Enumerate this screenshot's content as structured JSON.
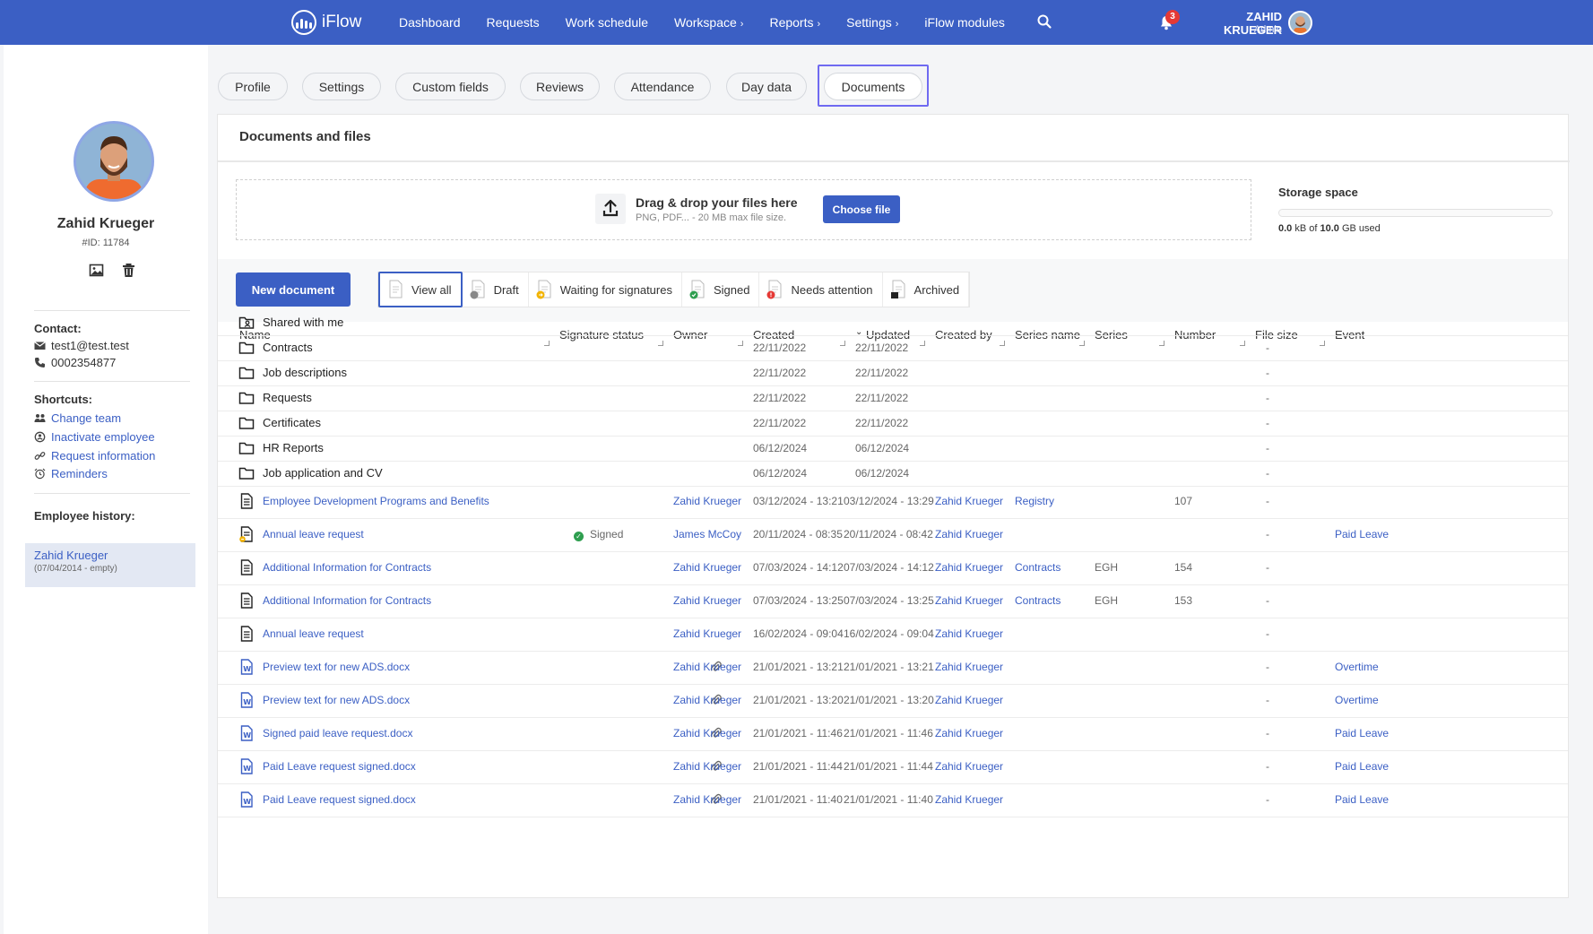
{
  "app": {
    "logo_text": "iFlow"
  },
  "nav": {
    "items": [
      {
        "label": "Dashboard",
        "chevron": false
      },
      {
        "label": "Requests",
        "chevron": false
      },
      {
        "label": "Work schedule",
        "chevron": false
      },
      {
        "label": "Workspace",
        "chevron": true
      },
      {
        "label": "Reports",
        "chevron": true
      },
      {
        "label": "Settings",
        "chevron": true
      },
      {
        "label": "iFlow modules",
        "chevron": false
      }
    ],
    "search_icon": "search-icon"
  },
  "user": {
    "name": "ZAHID KRUEGER",
    "role": "Admin",
    "notifications": "3"
  },
  "profile": {
    "name": "Zahid Krueger",
    "id": "#ID: 11784",
    "contact_title": "Contact:",
    "email": "test1@test.test",
    "phone": "0002354877",
    "shortcuts_title": "Shortcuts:",
    "shortcuts": [
      "Change team",
      "Inactivate employee",
      "Request information",
      "Reminders"
    ],
    "history_title": "Employee history:",
    "history_name": "Zahid Krueger",
    "history_date": "(07/04/2014 - empty)"
  },
  "tabs": [
    "Profile",
    "Settings",
    "Custom fields",
    "Reviews",
    "Attendance",
    "Day data",
    "Documents"
  ],
  "active_tab": "Documents",
  "documents": {
    "title": "Documents and files",
    "drop_title": "Drag & drop your files here",
    "drop_sub": "PNG, PDF... - 20 MB max file size.",
    "choose_label": "Choose file",
    "storage_title": "Storage space",
    "storage_used": "0.0",
    "storage_total": "10.0",
    "storage_fraction": 0.0,
    "storage_kb": "kB of",
    "storage_gb": "GB used",
    "new_doc_label": "New document",
    "filters": [
      "View all",
      "Draft",
      "Waiting for signatures",
      "Signed",
      "Needs attention",
      "Archived"
    ],
    "columns": [
      "Name",
      "Signature status",
      "Owner",
      "Created",
      "Updated",
      "Created by",
      "Series name",
      "Series",
      "Number",
      "File size",
      "Event"
    ],
    "folders": [
      {
        "name": "Shared with me",
        "created": "",
        "updated": "",
        "size": "",
        "shared": true
      },
      {
        "name": "Contracts",
        "created": "22/11/2022",
        "updated": "22/11/2022",
        "size": "-"
      },
      {
        "name": "Job descriptions",
        "created": "22/11/2022",
        "updated": "22/11/2022",
        "size": "-"
      },
      {
        "name": "Requests",
        "created": "22/11/2022",
        "updated": "22/11/2022",
        "size": "-"
      },
      {
        "name": "Certificates",
        "created": "22/11/2022",
        "updated": "22/11/2022",
        "size": "-"
      },
      {
        "name": "HR Reports",
        "created": "06/12/2024",
        "updated": "06/12/2024",
        "size": "-"
      },
      {
        "name": "Job application and CV",
        "created": "06/12/2024",
        "updated": "06/12/2024",
        "size": "-"
      }
    ],
    "files": [
      {
        "name": "Employee Development Programs and Benefits",
        "type": "doc",
        "sig": "",
        "attach": false,
        "owner": "Zahid Krueger",
        "created": "03/12/2024 - 13:21",
        "updated": "03/12/2024 - 13:29",
        "created_by": "Zahid Krueger",
        "series_name": "Registry",
        "series": "",
        "number": "107",
        "size": "-",
        "event": ""
      },
      {
        "name": "Annual leave request",
        "type": "doc-pending",
        "sig": "Signed",
        "attach": false,
        "owner": "James McCoy",
        "created": "20/11/2024 - 08:35",
        "updated": "20/11/2024 - 08:42",
        "created_by": "Zahid Krueger",
        "series_name": "",
        "series": "",
        "number": "",
        "size": "-",
        "event": "Paid Leave"
      },
      {
        "name": "Additional Information for Contracts",
        "type": "doc",
        "sig": "",
        "attach": false,
        "owner": "Zahid Krueger",
        "created": "07/03/2024 - 14:12",
        "updated": "07/03/2024 - 14:12",
        "created_by": "Zahid Krueger",
        "series_name": "Contracts",
        "series": "EGH",
        "number": "154",
        "size": "-",
        "event": ""
      },
      {
        "name": "Additional Information for Contracts",
        "type": "doc",
        "sig": "",
        "attach": false,
        "owner": "Zahid Krueger",
        "created": "07/03/2024 - 13:25",
        "updated": "07/03/2024 - 13:25",
        "created_by": "Zahid Krueger",
        "series_name": "Contracts",
        "series": "EGH",
        "number": "153",
        "size": "-",
        "event": ""
      },
      {
        "name": "Annual leave request",
        "type": "doc",
        "sig": "",
        "attach": false,
        "owner": "Zahid Krueger",
        "created": "16/02/2024 - 09:04",
        "updated": "16/02/2024 - 09:04",
        "created_by": "Zahid Krueger",
        "series_name": "",
        "series": "",
        "number": "",
        "size": "-",
        "event": ""
      },
      {
        "name": "Preview text for new ADS.docx",
        "type": "word",
        "sig": "",
        "attach": true,
        "owner": "Zahid Krueger",
        "created": "21/01/2021 - 13:21",
        "updated": "21/01/2021 - 13:21",
        "created_by": "Zahid Krueger",
        "series_name": "",
        "series": "",
        "number": "",
        "size": "-",
        "event": "Overtime"
      },
      {
        "name": "Preview text for new ADS.docx",
        "type": "word",
        "sig": "",
        "attach": true,
        "owner": "Zahid Krueger",
        "created": "21/01/2021 - 13:20",
        "updated": "21/01/2021 - 13:20",
        "created_by": "Zahid Krueger",
        "series_name": "",
        "series": "",
        "number": "",
        "size": "-",
        "event": "Overtime"
      },
      {
        "name": "Signed paid leave request.docx",
        "type": "word",
        "sig": "",
        "attach": true,
        "owner": "Zahid Krueger",
        "created": "21/01/2021 - 11:46",
        "updated": "21/01/2021 - 11:46",
        "created_by": "Zahid Krueger",
        "series_name": "",
        "series": "",
        "number": "",
        "size": "-",
        "event": "Paid Leave"
      },
      {
        "name": "Paid Leave request signed.docx",
        "type": "word",
        "sig": "",
        "attach": true,
        "owner": "Zahid Krueger",
        "created": "21/01/2021 - 11:44",
        "updated": "21/01/2021 - 11:44",
        "created_by": "Zahid Krueger",
        "series_name": "",
        "series": "",
        "number": "",
        "size": "-",
        "event": "Paid Leave"
      },
      {
        "name": "Paid Leave request signed.docx",
        "type": "word",
        "sig": "",
        "attach": true,
        "owner": "Zahid Krueger",
        "created": "21/01/2021 - 11:40",
        "updated": "21/01/2021 - 11:40",
        "created_by": "Zahid Krueger",
        "series_name": "",
        "series": "",
        "number": "",
        "size": "-",
        "event": "Paid Leave"
      }
    ]
  },
  "colors": {
    "brand": "#3b5fc4",
    "signed": "#2e9e4f",
    "badge": "#e53935",
    "active_frame": "#6f6af1"
  }
}
